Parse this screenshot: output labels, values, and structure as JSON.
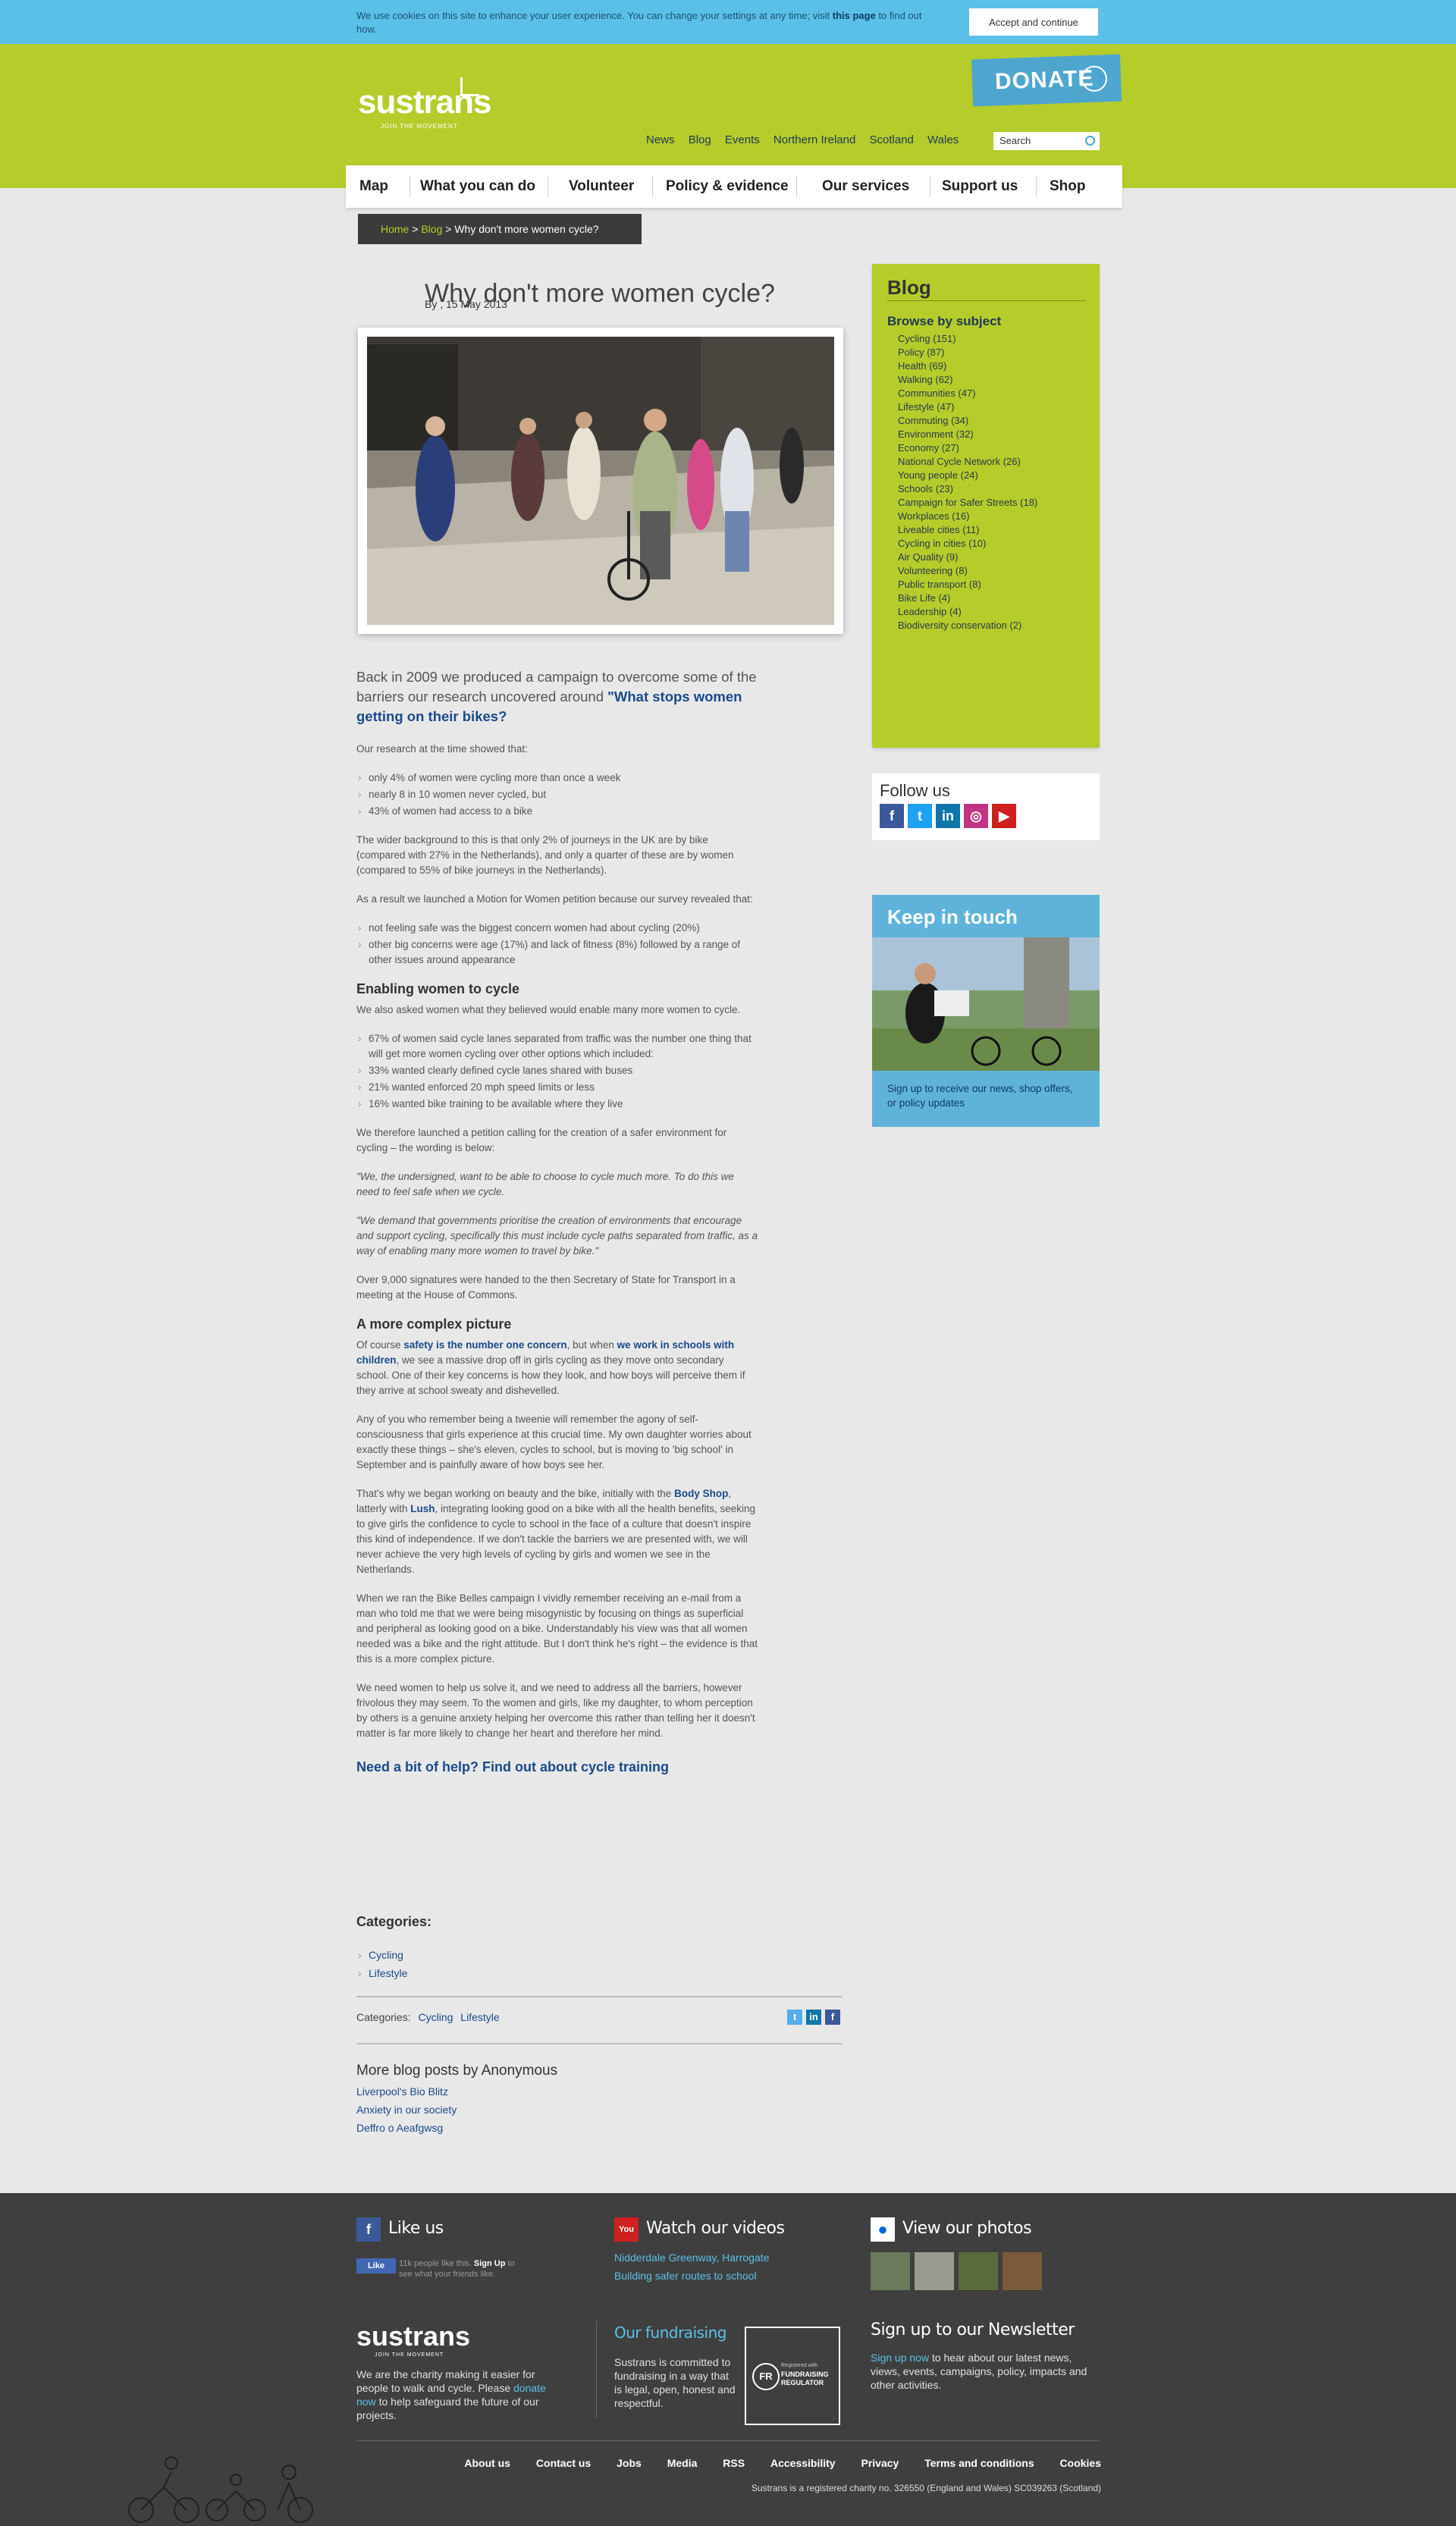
{
  "cookie": {
    "text": "We use cookies on this site to enhance your user experience. You can change your settings at any time; visit ",
    "link": "this page",
    "text_end": " to find out how.",
    "accept": "Accept and continue"
  },
  "header": {
    "logo": "sustrans",
    "tagline": "JOIN THE MOVEMENT",
    "donate": "DONATE",
    "top_nav": [
      "News",
      "Blog",
      "Events",
      "Northern Ireland",
      "Scotland",
      "Wales"
    ],
    "search_placeholder": "Search",
    "main_nav": [
      "Map",
      "What you can do",
      "Volunteer",
      "Policy & evidence",
      "Our services",
      "Support us",
      "Shop"
    ]
  },
  "breadcrumb": {
    "home": "Home",
    "sep": ">",
    "blog": "Blog",
    "current": "Why don't more women cycle?"
  },
  "article": {
    "title": "Why don't more women cycle?",
    "byline": "By , 15 May 2013",
    "lead": "Back in 2009 we produced a campaign to overcome some of the barriers our research uncovered around ",
    "lead_link": "\"What stops women getting on their bikes?",
    "p1": "Our research at the time showed that:",
    "list1": [
      "only 4% of women were cycling more than once a week",
      "nearly 8 in 10 women never cycled, but",
      "43% of women had access to a bike"
    ],
    "p2": "The wider background to this is that only 2% of journeys in the UK are by bike (compared with 27% in the Netherlands), and only a quarter of these are by women (compared to 55% of bike journeys in the Netherlands).",
    "p3": "As a result we launched a Motion for Women petition because our survey revealed that:",
    "list2": [
      "not feeling safe was the biggest concern women had about cycling (20%)",
      "other big concerns were age (17%) and lack of fitness (8%) followed by a range of other issues around appearance"
    ],
    "h_enabling": "Enabling women to cycle",
    "p4": "We also asked women what they believed would enable many more women to cycle.",
    "list3": [
      "67% of women said cycle lanes separated from traffic was the number one thing that will get more women cycling over other options which included:",
      "33% wanted clearly defined cycle lanes shared with buses",
      "21% wanted enforced 20 mph speed limits or less",
      "16% wanted bike training to be available where they live"
    ],
    "p5": "We therefore launched a petition calling for the creation of a safer environment for cycling – the wording is below:",
    "q1": "\"We, the undersigned, want to be able to choose to cycle much more. To do this we need to feel safe when we cycle.",
    "q2": "\"We demand that governments prioritise the creation of environments that encourage and support cycling, specifically this must include cycle paths separated from traffic, as a way of enabling many more women to travel by bike.\"",
    "p6": "Over 9,000 signatures were handed to the then Secretary of State for Transport in a meeting at the House of Commons.",
    "h_complex": "A more complex picture",
    "p7a": "Of course ",
    "p7_link1": "safety is the number one concern",
    "p7b": ", but when ",
    "p7_link2": "we work in schools with children",
    "p7c": ", we see a massive drop off in girls cycling as they move onto secondary school.  One of their key concerns is how they look, and how boys will perceive them if they arrive at school sweaty and dishevelled.",
    "p8": "Any of you who remember being a tweenie will remember the agony of self-consciousness that girls experience at this crucial time.  My own daughter worries about exactly these things – she's eleven, cycles to school, but is moving to 'big school' in September and is painfully aware of how boys see her.",
    "p9a": "That's why we began working on beauty and the bike, initially with the ",
    "p9_link1": "Body Shop",
    "p9b": ", latterly with ",
    "p9_link2": "Lush",
    "p9c": ", integrating looking good on a bike with all the health benefits, seeking to give girls the confidence to cycle to school in the face of a culture that doesn't inspire this kind of independence.  If we don't tackle the barriers we are presented with, we will never achieve the very high levels of cycling by girls and women we see in the Netherlands.",
    "p10": "When we ran the Bike Belles campaign I vividly remember receiving an e-mail from a man who told me that we were being misogynistic by focusing on things as superficial and peripheral as looking good on a bike.  Understandably his view was that all women needed was a bike and the right attitude.  But I don't think he's right – the evidence is that this is a more complex picture.",
    "p11": "We need women to help us solve it, and we need to address all the barriers, however frivolous they may seem. To the women and girls, like my daughter, to whom perception by others is a genuine anxiety helping her overcome this rather than telling her it doesn't matter is far more likely to change her heart and therefore her mind.",
    "help_link": "Need a bit of help? Find out about cycle training"
  },
  "categories": {
    "heading": "Categories:",
    "items": [
      "Cycling",
      "Lifestyle"
    ],
    "row_label": "Categories:"
  },
  "more_posts": {
    "heading": "More blog posts by Anonymous",
    "items": [
      "Liverpool's Bio Blitz",
      "Anxiety in our society",
      "Deffro o Aeafgwsg"
    ]
  },
  "sidebar": {
    "blog_title": "Blog",
    "browse": "Browse by subject",
    "subjects": [
      "Cycling (151)",
      "Policy (87)",
      "Health (69)",
      "Walking (62)",
      "Communities (47)",
      "Lifestyle (47)",
      "Commuting (34)",
      "Environment (32)",
      "Economy (27)",
      "National Cycle Network (26)",
      "Young people (24)",
      "Schools (23)",
      "Campaign for Safer Streets (18)",
      "Workplaces (16)",
      "Liveable cities (11)",
      "Cycling in cities (10)",
      "Air Quality (9)",
      "Volunteering (8)",
      "Public transport (8)",
      "Bike Life (4)",
      "Leadership (4)",
      "Biodiversity conservation (2)"
    ],
    "follow_title": "Follow us",
    "keep_title": "Keep in touch",
    "keep_text": "Sign up to receive our news, shop offers, or policy updates"
  },
  "footer": {
    "like_us": "Like us",
    "like_btn": "Like",
    "like_text_a": "11k people like this. ",
    "like_signup": "Sign Up",
    "like_text_b": " to see what your friends like.",
    "watch": "Watch our videos",
    "videos": [
      "Nidderdale Greenway, Harrogate",
      "Building safer routes to school"
    ],
    "photos": "View our photos",
    "logo": "sustrans",
    "tagline": "JOIN THE MOVEMENT",
    "charity_a": "We are the charity making it easier for people to walk and cycle. Please ",
    "donate_link": "donate now",
    "charity_b": " to help safeguard the future of our projects.",
    "fundraising_head": "Our fundraising",
    "fundraising_text": "Sustrans is committed to fundraising in a way that is legal, open, honest and respectful.",
    "regulator": "FUNDRAISING REGULATOR",
    "registered": "Registered with",
    "newsletter_head": "Sign up to our Newsletter",
    "newsletter_link": "Sign up now",
    "newsletter_text": " to hear about our latest news, views, events, campaigns, policy, impacts and other activities.",
    "links": [
      "About us",
      "Contact us",
      "Jobs",
      "Media",
      "RSS",
      "Accessibility",
      "Privacy",
      "Terms and conditions",
      "Cookies"
    ],
    "legal": "Sustrans is a registered charity no. 326550 (England and Wales) SC039263 (Scotland)"
  },
  "colors": {
    "lime": "#b5cc2b",
    "sky": "#5bc0e8",
    "navy": "#1a4a8a",
    "footer": "#3f3f3f"
  }
}
